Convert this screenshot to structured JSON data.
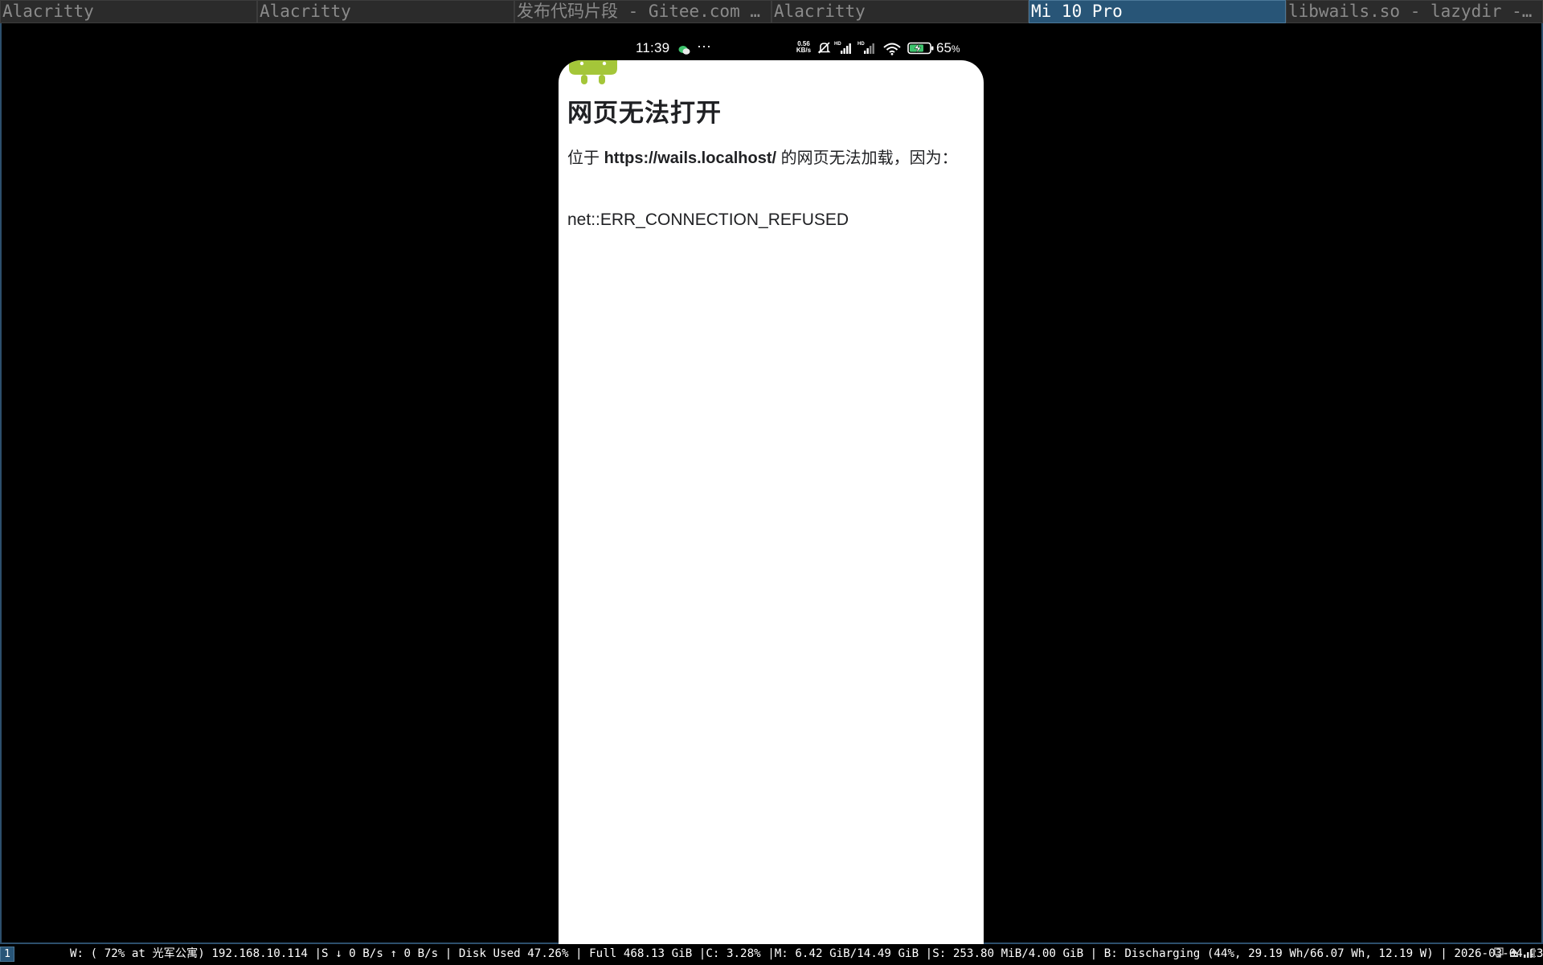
{
  "tabs": [
    {
      "title": "Alacritty",
      "active": false
    },
    {
      "title": "Alacritty",
      "active": false
    },
    {
      "title": "发布代码片段 - Gitee.com …",
      "active": false
    },
    {
      "title": "Alacritty",
      "active": false
    },
    {
      "title": "Mi 10 Pro",
      "active": true
    },
    {
      "title": "libwails.so - lazydir -…",
      "active": false
    }
  ],
  "phone": {
    "statusbar": {
      "time": "11:39",
      "more": "···",
      "net_speed_value": "0.56",
      "net_speed_unit": "KB/s",
      "battery_percent": "65",
      "battery_unit": "%",
      "icons": [
        "wechat-icon",
        "mute-icon",
        "signal-hd-icon",
        "signal-hd-icon",
        "wifi-icon",
        "battery-charging-icon"
      ]
    },
    "page": {
      "title": "网页无法打开",
      "desc_prefix": "位于 ",
      "url": "https://wails.localhost/",
      "desc_suffix": " 的网页无法加载，因为：",
      "error_code": "net::ERR_CONNECTION_REFUSED"
    }
  },
  "bottombar": {
    "workspace": "1",
    "status": "W: ( 72% at 光军公寓) 192.168.10.114 |S ↓ 0 B/s ↑ 0 B/s | Disk Used 47.26% | Full 468.13 GiB |C: 3.28% |M: 6.42 GiB/14.49 GiB |S: 253.80 MiB/4.00 GiB | B: Discharging (44%, 29.19 Wh/66.07 Wh, 12.19 W) | 2026-03-04 23:39:02",
    "tray_icons": [
      "network-icon",
      "eject-icon",
      "signal-bars-icon"
    ]
  },
  "colors": {
    "accent": "#285577",
    "accent_border": "#4c7899",
    "android_green": "#a4c639"
  }
}
